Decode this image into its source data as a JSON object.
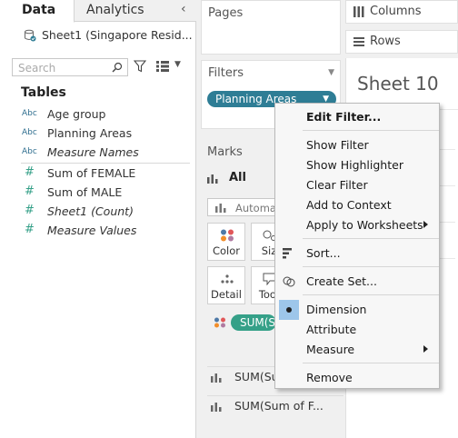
{
  "data_pane": {
    "tabs": [
      {
        "label": "Data"
      },
      {
        "label": "Analytics"
      }
    ],
    "collapse_glyph": "‹",
    "datasource": "Sheet1 (Singapore Resid...",
    "search_placeholder": "Search",
    "tables_heading": "Tables",
    "fields": [
      {
        "type": "Abc",
        "name": "Age group"
      },
      {
        "type": "Abc",
        "name": "Planning Areas"
      },
      {
        "type": "Abc",
        "name": "Measure Names"
      },
      {
        "type": "#",
        "name": "Sum of FEMALE"
      },
      {
        "type": "#",
        "name": "Sum of MALE"
      },
      {
        "type": "#",
        "name": "Sheet1 (Count)"
      },
      {
        "type": "#",
        "name": "Measure Values"
      }
    ]
  },
  "shelves": {
    "pages_title": "Pages",
    "filters_title": "Filters",
    "filter_pill": "Planning Areas",
    "marks_title": "Marks",
    "marks_all": "All",
    "mark_type": "Automati",
    "mark_buttons": [
      {
        "label": "Color"
      },
      {
        "label": "Siz"
      },
      {
        "label": "Detail"
      },
      {
        "label": "Tool"
      }
    ],
    "sum_pill": "SUM(S",
    "marks_rows": [
      {
        "label": "SUM(Su"
      },
      {
        "label": "SUM(Sum of F..."
      }
    ]
  },
  "view": {
    "columns_label": "Columns",
    "rows_label": "Rows",
    "sheet_title": "Sheet 10"
  },
  "context_menu": {
    "items": [
      {
        "label": "Edit Filter...",
        "bold": true
      },
      {
        "label": "Show Filter"
      },
      {
        "label": "Show Highlighter"
      },
      {
        "label": "Clear Filter"
      },
      {
        "label": "Add to Context"
      },
      {
        "label": "Apply to Worksheets",
        "submenu": true
      },
      {
        "label": "Sort..."
      },
      {
        "label": "Create Set..."
      },
      {
        "label": "Dimension",
        "checked": true
      },
      {
        "label": "Attribute"
      },
      {
        "label": "Measure",
        "submenu": true
      },
      {
        "label": "Remove"
      }
    ]
  },
  "colors": {
    "pill_blue": "#2e7d95",
    "pill_green": "#35a088",
    "dimension_highlight": "#9dc6ea"
  }
}
